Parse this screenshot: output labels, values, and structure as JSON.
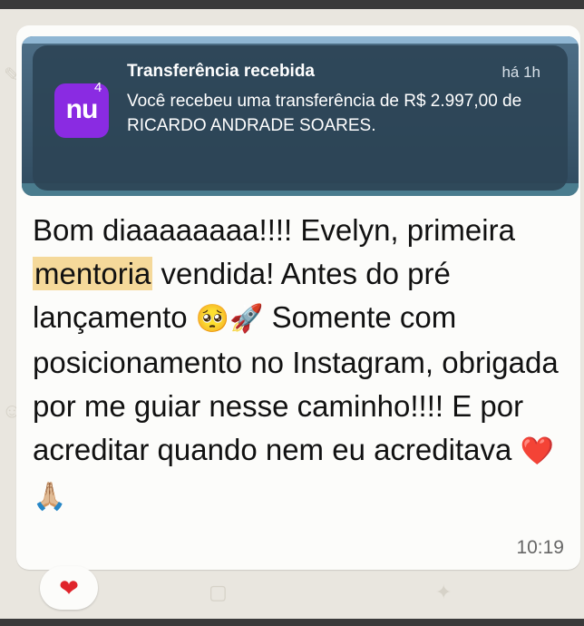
{
  "notification": {
    "app_icon": "nu",
    "badge_count": "4",
    "title": "Transferência recebida",
    "time": "há 1h",
    "body": "Você recebeu uma transferência de R$ 2.997,00 de RICARDO ANDRADE SOARES."
  },
  "message": {
    "part1": "Bom diaaaaaaaa!!!! Evelyn, primeira ",
    "highlight": "mentoria",
    "part2": " vendida! Antes do pré lançamento",
    "emoji1": "🥺🚀",
    "part3": "Somente com posicionamento no Instagram, obrigada por me guiar nesse caminho!!!! E por acreditar quando nem eu acreditava",
    "emoji2": "❤️🙏🏼",
    "time": "10:19"
  },
  "reaction": {
    "icon": "heart-icon",
    "glyph": "❤"
  },
  "colors": {
    "brand": "#8a2be2",
    "highlight": "#f5d99a",
    "reaction": "#e0242b"
  }
}
